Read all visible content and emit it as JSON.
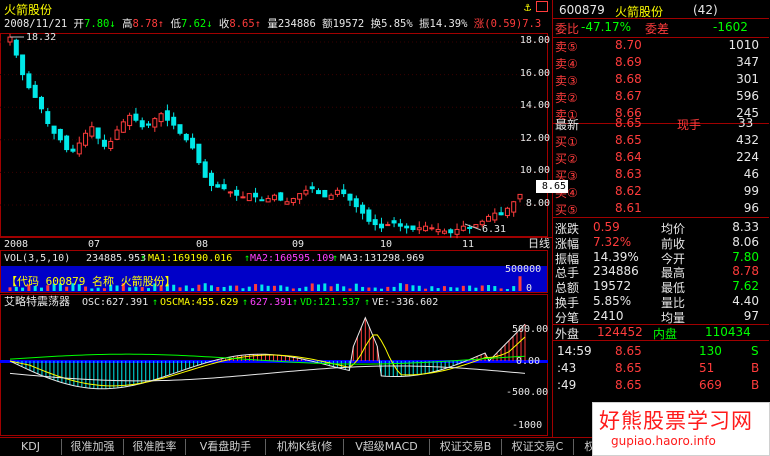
{
  "stock": {
    "name": "火箭股份",
    "date": "2008/11/21",
    "open_label": "开",
    "open": "7.80",
    "high_label": "高",
    "high": "8.78",
    "low_label": "低",
    "low": "7.62",
    "close_label": "收",
    "close": "8.65",
    "volume_label": "量",
    "volume": "234886",
    "amount_label": "额",
    "amount": "19572",
    "turnover_label": "换",
    "turnover": "5.85%",
    "amplitude_label": "振",
    "amplitude": "14.39%",
    "change_label": "涨",
    "change": "(0.59)7.3",
    "max_marker": "18.32",
    "min_marker": "6.31",
    "last_tag": "8.65"
  },
  "price_axis": [
    "18.00",
    "16.00",
    "14.00",
    "12.00",
    "10.00",
    "8.00"
  ],
  "month_labels": [
    "2008",
    "07",
    "08",
    "09",
    "10",
    "11"
  ],
  "period_label": "日线",
  "vol_bar": {
    "text": "VOL(3,5,10)",
    "v": "234885.953",
    "ma1": "MA1:169190.016",
    "ma2": "MA2:160595.109",
    "ma3": "MA3:131298.969",
    "axis": [
      "500000",
      "0"
    ],
    "caption": "【代码 600879 名称 火箭股份】"
  },
  "osc": {
    "title": "艾略特震荡器",
    "osc": "OSC:627.391",
    "oscma": "OSCMA:455.629",
    "val3": "627.391",
    "vd": "VD:121.537",
    "ve": "VE:-336.602",
    "axis": [
      "500.00",
      "0.00",
      "-500.00",
      "-1000"
    ]
  },
  "quote": {
    "code": "600879",
    "name": "火箭股份",
    "count": "(42)",
    "weibi_label": "委比",
    "weibi": "-47.17%",
    "weicha_label": "委差",
    "weicha": "-1602",
    "sells": [
      {
        "label": "卖⑤",
        "price": "8.70",
        "vol": "1010"
      },
      {
        "label": "卖④",
        "price": "8.69",
        "vol": "347"
      },
      {
        "label": "卖③",
        "price": "8.68",
        "vol": "301"
      },
      {
        "label": "卖②",
        "price": "8.67",
        "vol": "596"
      },
      {
        "label": "卖①",
        "price": "8.66",
        "vol": "245"
      }
    ],
    "latest_label": "最新",
    "latest": "8.65",
    "hand_label": "现手",
    "hand": "33",
    "buys": [
      {
        "label": "买①",
        "price": "8.65",
        "vol": "432"
      },
      {
        "label": "买②",
        "price": "8.64",
        "vol": "224"
      },
      {
        "label": "买③",
        "price": "8.63",
        "vol": "46"
      },
      {
        "label": "买④",
        "price": "8.62",
        "vol": "99"
      },
      {
        "label": "买⑤",
        "price": "8.61",
        "vol": "96"
      }
    ],
    "stats": [
      {
        "l1": "涨跌",
        "v1": "0.59",
        "l2": "均价",
        "v2": "8.33",
        "c1": "red",
        "c2": "wht"
      },
      {
        "l1": "涨幅",
        "v1": "7.32%",
        "l2": "前收",
        "v2": "8.06",
        "c1": "red",
        "c2": "wht"
      },
      {
        "l1": "振幅",
        "v1": "14.39%",
        "l2": "今开",
        "v2": "7.80",
        "c1": "wht",
        "c2": "grn"
      },
      {
        "l1": "总手",
        "v1": "234886",
        "l2": "最高",
        "v2": "8.78",
        "c1": "wht",
        "c2": "red"
      },
      {
        "l1": "总额",
        "v1": "19572",
        "l2": "最低",
        "v2": "7.62",
        "c1": "wht",
        "c2": "grn"
      },
      {
        "l1": "换手",
        "v1": "5.85%",
        "l2": "量比",
        "v2": "4.40",
        "c1": "wht",
        "c2": "wht"
      },
      {
        "l1": "分笔",
        "v1": "2410",
        "l2": "均量",
        "v2": "97",
        "c1": "wht",
        "c2": "wht"
      }
    ],
    "outer_label": "外盘",
    "outer": "124452",
    "inner_label": "内盘",
    "inner": "110434",
    "ticks": [
      {
        "time": "14:59",
        "price": "8.65",
        "vol": "130",
        "flag": "S"
      },
      {
        "time": ":43",
        "price": "8.65",
        "vol": "51",
        "flag": "B"
      },
      {
        "time": ":49",
        "price": "8.65",
        "vol": "669",
        "flag": "B"
      }
    ]
  },
  "tabs": [
    "KDJ",
    "很准加强",
    "很准胜率",
    "V看盘助手",
    "机构K线(修",
    "V超级MACD",
    "权证交易B",
    "权证交易C",
    "权证交易F",
    "日分隔线"
  ],
  "watermark": {
    "line1": "好熊股票学习网",
    "line2": "gupiao.haoro.info"
  }
}
